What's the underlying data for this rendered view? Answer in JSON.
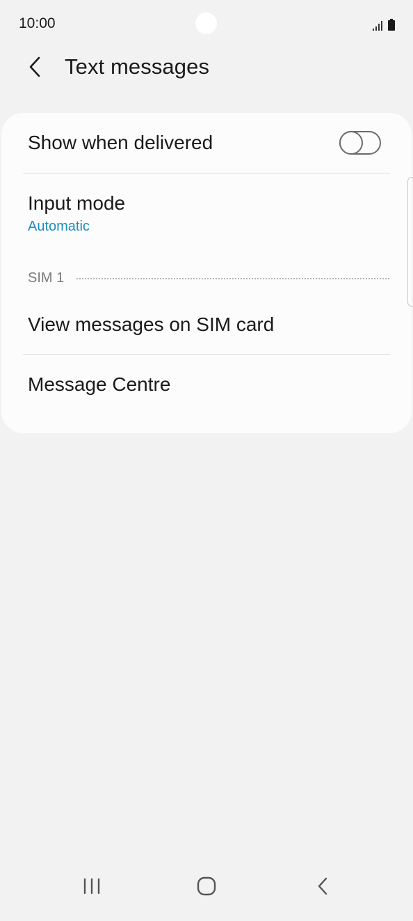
{
  "status_bar": {
    "time": "10:00",
    "icons": [
      "signal-icon",
      "battery-icon"
    ]
  },
  "header": {
    "back_icon": "chevron-left-icon",
    "title": "Text messages"
  },
  "settings": {
    "show_when_delivered": {
      "label": "Show when delivered",
      "toggle_on": false
    },
    "input_mode": {
      "label": "Input mode",
      "value": "Automatic"
    },
    "section_header": "SIM 1",
    "view_messages": {
      "label": "View messages on SIM card"
    },
    "message_centre": {
      "label": "Message Centre"
    }
  },
  "colors": {
    "background": "#f2f2f2",
    "card": "#fcfcfc",
    "accent": "#1e8cbf",
    "text": "#1a1a1a",
    "muted": "#7a7a7a"
  },
  "nav_bar": {
    "icons": [
      "recents-icon",
      "home-icon",
      "back-icon"
    ]
  }
}
